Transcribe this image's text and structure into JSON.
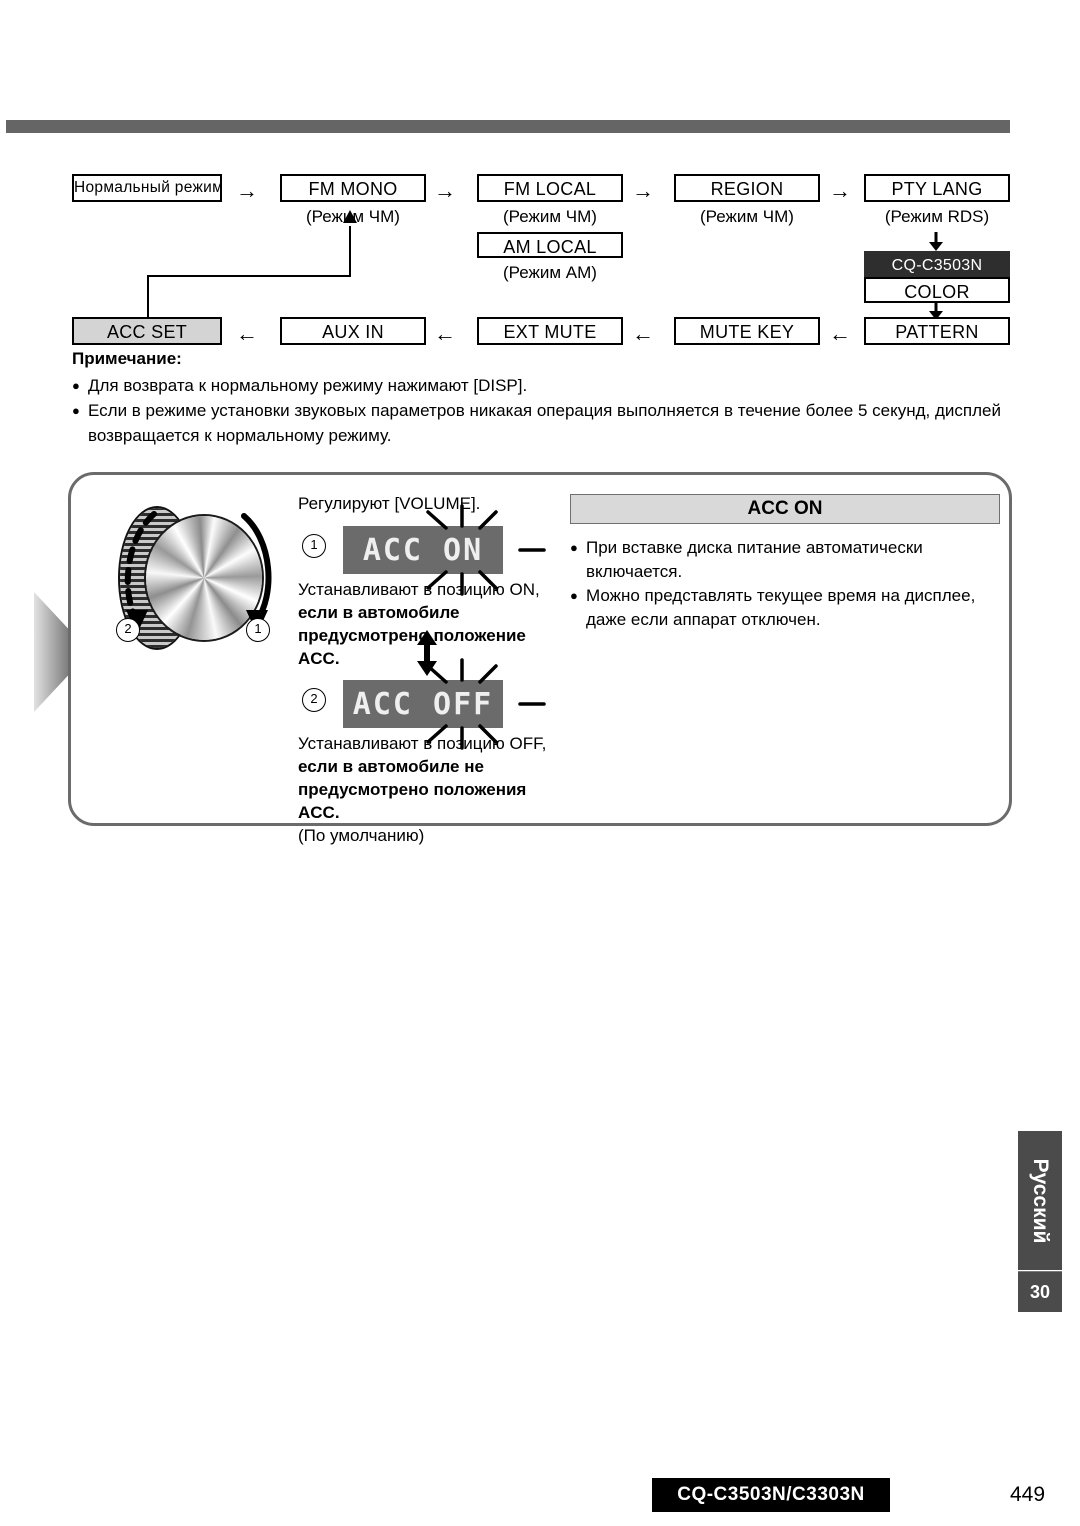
{
  "flow": {
    "nodes": [
      {
        "id": "normal",
        "label": "Нормальный режим",
        "sub": ""
      },
      {
        "id": "fm_mono",
        "label": "FM MONO",
        "sub": "(Режим ЧМ)"
      },
      {
        "id": "fm_local",
        "label": "FM LOCAL",
        "sub": "(Режим ЧМ)"
      },
      {
        "id": "am_local",
        "label": "AM LOCAL",
        "sub": "(Режим АМ)"
      },
      {
        "id": "region",
        "label": "REGION",
        "sub": "(Режим ЧМ)"
      },
      {
        "id": "pty_lang",
        "label": "PTY LANG",
        "sub": "(Режим RDS)"
      },
      {
        "id": "model",
        "label": "CQ-C3503N",
        "sub": ""
      },
      {
        "id": "color",
        "label": "COLOR",
        "sub": ""
      },
      {
        "id": "pattern",
        "label": "PATTERN",
        "sub": ""
      },
      {
        "id": "mute_key",
        "label": "MUTE KEY",
        "sub": ""
      },
      {
        "id": "ext_mute",
        "label": "EXT MUTE",
        "sub": ""
      },
      {
        "id": "aux_in",
        "label": "AUX IN",
        "sub": ""
      },
      {
        "id": "acc_set",
        "label": "ACC SET",
        "sub": ""
      }
    ],
    "arrow_right": "→",
    "arrow_left": "←"
  },
  "notes": {
    "title": "Примечание:",
    "bullet": "●",
    "items": [
      "Для возврата к нормальному режиму нажимают [DISP].",
      "Если в режиме установки звуковых параметров никакая операция выполняется в течение более 5 секунд, дисплей возвращается к нормальному режиму."
    ],
    "emphasis_1": "[DISP]"
  },
  "panel": {
    "knob": {
      "marker_cw": "1",
      "marker_ccw": "2"
    },
    "lead": "Регулируют [VOLUME].",
    "lead_bold": "[VOLUME]",
    "step1": {
      "num": "1",
      "display": "ACC ON",
      "caption_normal": "Устанавливают в позицию ON,",
      "caption_bold": "если в автомобиле предусмотрено положение ACC."
    },
    "step2": {
      "num": "2",
      "display": "ACC OFF",
      "caption_normal": "Устанавливают в позицию OFF,",
      "caption_bold": "если в автомобиле не предусмотрено положения ACC.",
      "caption_tail": "(По умолчанию)"
    }
  },
  "callout": {
    "title": "ACC ON",
    "bullet": "●",
    "items": [
      "При вставке диска питание автоматически включается.",
      "Можно представлять текущее время на дисплее, даже если аппарат отключен."
    ]
  },
  "side": {
    "language": "Русский",
    "page": "30"
  },
  "footer": {
    "model": "CQ-C3503N/C3303N",
    "folio": "449"
  },
  "colors": {
    "rule": "#656565",
    "shaded_box": "#d4d4d4",
    "dark_box": "#2e2e2e",
    "lcd_bg": "#6b6b6b",
    "panel_border": "#6b6b6b",
    "side_tab": "#4b4b4b"
  }
}
